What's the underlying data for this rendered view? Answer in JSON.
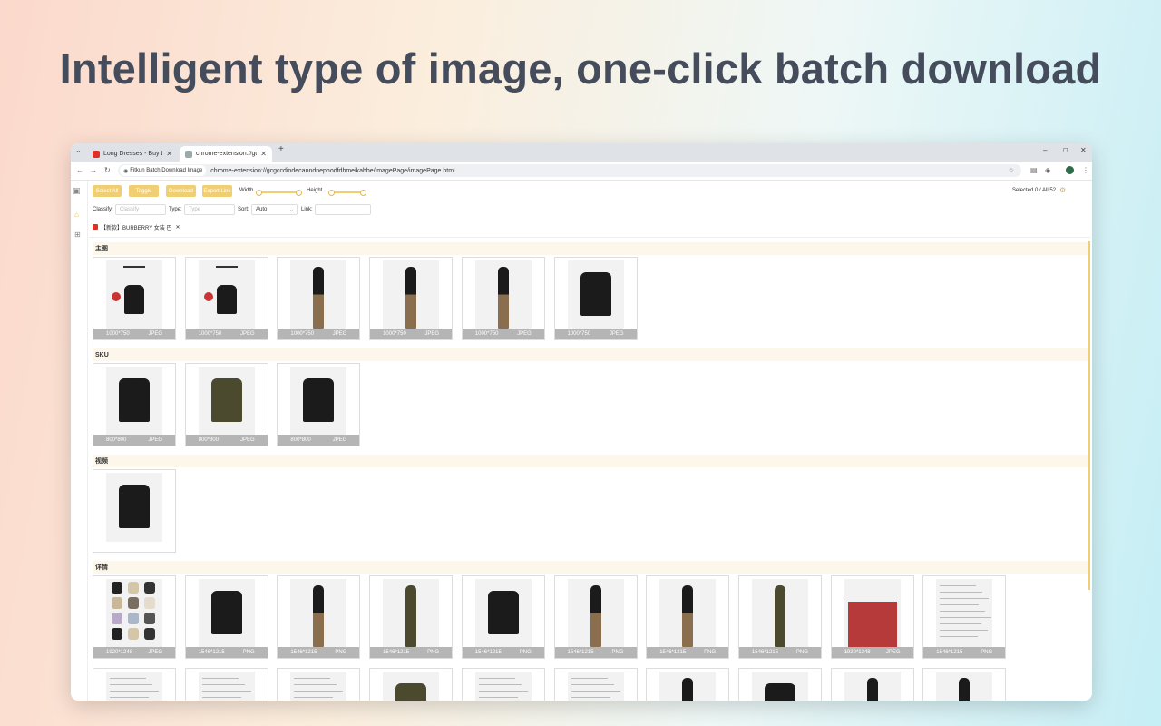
{
  "headline": "Intelligent type of image, one-click batch download",
  "browser": {
    "tabs": [
      {
        "title": "Long Dresses - Buy Long Dres",
        "active": false,
        "favicon_color": "#d9322a"
      },
      {
        "title": "chrome-extension://gcgccdio",
        "active": true,
        "favicon_color": "#888888"
      }
    ],
    "new_tab_symbol": "+",
    "window_controls": [
      "–",
      "◻",
      "✕"
    ],
    "nav": {
      "back": "←",
      "forward": "→",
      "reload": "↻"
    },
    "ext_chip_label": "Fitkun Batch Download Image",
    "url": "chrome-extension://gcgccdiodecanndnephodfdhmeikahbe/imagePage/imagePage.html",
    "profile_initial": "",
    "menu_icon": "⋮"
  },
  "toolbar": {
    "select_all": "Select All",
    "toggle": "Toggle",
    "download": "Download",
    "export_link": "Export Link",
    "width_label": "Width",
    "height_label": "Height",
    "selected_status": "Selected 0 / All 52"
  },
  "filters": {
    "classify_label": "Classify:",
    "classify_placeholder": "Classify",
    "type_label": "Type:",
    "type_placeholder": "Type",
    "sort_label": "Sort:",
    "sort_value": "Auto",
    "link_label": "Link:"
  },
  "page_tab": {
    "title": "【新款】BURBERRY 女装 巴",
    "close": "✕"
  },
  "accent_color": "#f0cf74",
  "sections": [
    {
      "title": "主图",
      "cards": [
        {
          "size": "1000*750",
          "type": "JPEG",
          "kind": "banner"
        },
        {
          "size": "1000*750",
          "type": "JPEG",
          "kind": "banner"
        },
        {
          "size": "1000*750",
          "type": "JPEG",
          "kind": "person"
        },
        {
          "size": "1000*750",
          "type": "JPEG",
          "kind": "person"
        },
        {
          "size": "1000*750",
          "type": "JPEG",
          "kind": "person"
        },
        {
          "size": "1000*750",
          "type": "JPEG",
          "kind": "coat"
        }
      ]
    },
    {
      "title": "SKU",
      "cards": [
        {
          "size": "800*800",
          "type": "JPEG",
          "kind": "coat"
        },
        {
          "size": "800*800",
          "type": "JPEG",
          "kind": "coat-olive"
        },
        {
          "size": "800*800",
          "type": "JPEG",
          "kind": "coat"
        }
      ]
    },
    {
      "title": "视频",
      "cards": [
        {
          "size": "",
          "type": "",
          "kind": "coat"
        }
      ]
    },
    {
      "title": "详情",
      "cards": [
        {
          "size": "1920*1248",
          "type": "JPEG",
          "kind": "grid"
        },
        {
          "size": "1546*1215",
          "type": "PNG",
          "kind": "coat"
        },
        {
          "size": "1546*1215",
          "type": "PNG",
          "kind": "person"
        },
        {
          "size": "1546*1215",
          "type": "PNG",
          "kind": "person-olive"
        },
        {
          "size": "1546*1215",
          "type": "PNG",
          "kind": "coat"
        },
        {
          "size": "1546*1215",
          "type": "PNG",
          "kind": "person"
        },
        {
          "size": "1546*1215",
          "type": "PNG",
          "kind": "person"
        },
        {
          "size": "1546*1215",
          "type": "PNG",
          "kind": "person-olive"
        },
        {
          "size": "1920*1248",
          "type": "JPEG",
          "kind": "red"
        },
        {
          "size": "1546*1215",
          "type": "PNG",
          "kind": "text"
        }
      ]
    }
  ],
  "extra_row_kinds": [
    "text",
    "text",
    "text",
    "coat-olive",
    "text",
    "text",
    "person",
    "coat",
    "person",
    "person"
  ]
}
